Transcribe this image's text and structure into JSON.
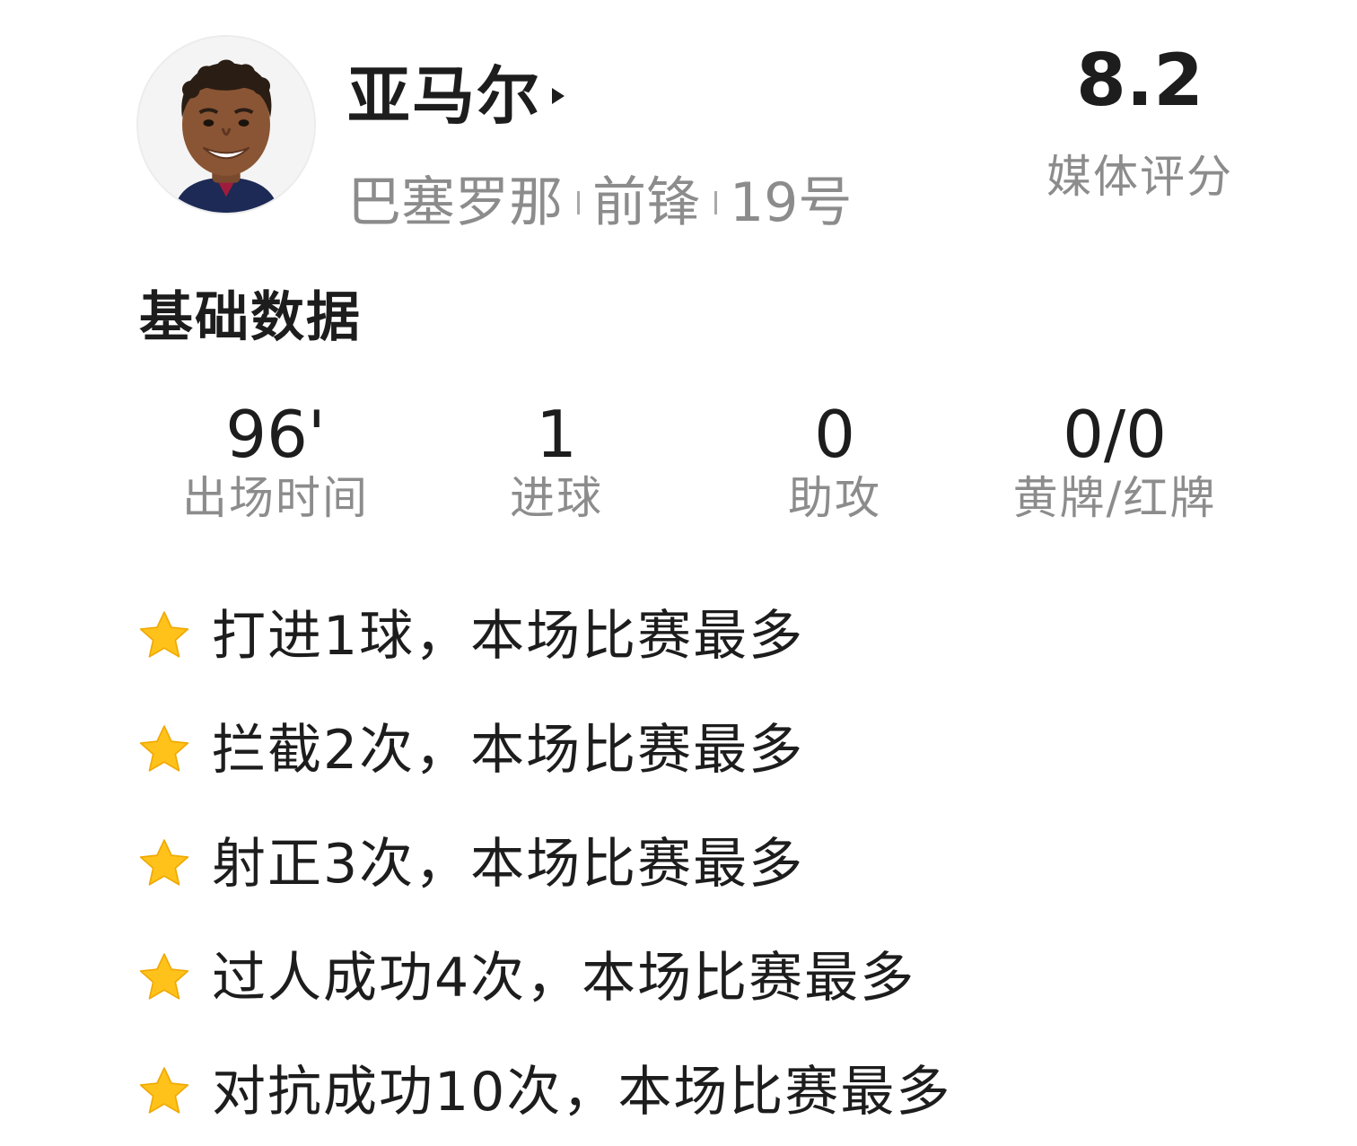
{
  "player": {
    "name": "亚马尔",
    "team": "巴塞罗那",
    "position": "前锋",
    "number": "19号"
  },
  "rating": {
    "value": "8.2",
    "label": "媒体评分"
  },
  "section": {
    "title": "基础数据"
  },
  "stats": [
    {
      "value": "96'",
      "label": "出场时间"
    },
    {
      "value": "1",
      "label": "进球"
    },
    {
      "value": "0",
      "label": "助攻"
    },
    {
      "value": "0/0",
      "label": "黄牌/红牌"
    }
  ],
  "highlights": [
    {
      "icon": "star-icon",
      "text": "打进1球，本场比赛最多"
    },
    {
      "icon": "star-icon",
      "text": "拦截2次，本场比赛最多"
    },
    {
      "icon": "star-icon",
      "text": "射正3次，本场比赛最多"
    },
    {
      "icon": "star-icon",
      "text": "过人成功4次，本场比赛最多"
    },
    {
      "icon": "star-icon",
      "text": "对抗成功10次，本场比赛最多"
    }
  ],
  "colors": {
    "primary_text": "#1d1d1d",
    "secondary_text": "#8c8c8c",
    "star": "#ffc21a",
    "background": "#ffffff"
  }
}
